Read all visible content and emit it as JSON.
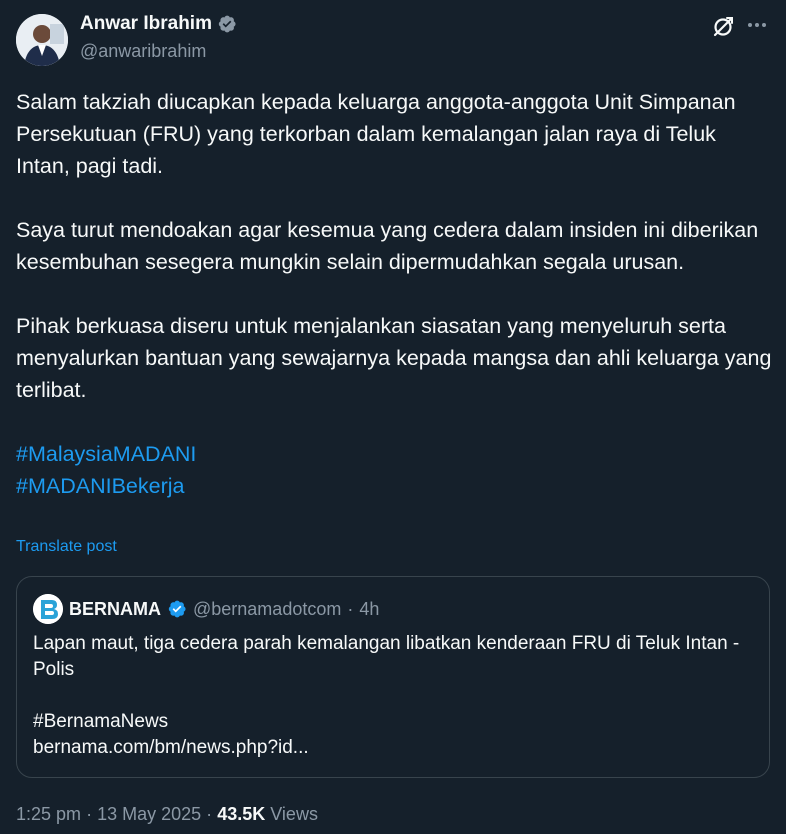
{
  "author": {
    "name": "Anwar Ibrahim",
    "handle": "@anwaribrahim",
    "verified": true
  },
  "post": {
    "paragraphs": [
      "Salam takziah diucapkan kepada keluarga anggota-anggota Unit Simpanan Persekutuan (FRU) yang terkorban dalam kemalangan jalan raya di Teluk Intan, pagi tadi.",
      "Saya turut mendoakan agar kesemua yang cedera dalam insiden ini diberikan kesembuhan sesegera mungkin selain dipermudahkan segala urusan.",
      "Pihak berkuasa diseru untuk menjalankan siasatan yang menyeluruh serta menyalurkan bantuan yang sewajarnya kepada mangsa dan ahli keluarga yang terlibat."
    ],
    "hashtags": [
      "#MalaysiaMADANI",
      "#MADANIBekerja"
    ],
    "translate_label": "Translate post"
  },
  "quote": {
    "name": "BERNAMA",
    "handle": "@bernamadotcom",
    "separator": "·",
    "time": "4h",
    "verified": true,
    "headline": "Lapan maut, tiga cedera parah kemalangan libatkan kenderaan FRU di Teluk Intan - Polis",
    "hashtag": "#BernamaNews",
    "link": "bernama.com/bm/news.php?id..."
  },
  "meta": {
    "time": "1:25 pm",
    "sep1": "·",
    "date": "13 May 2025",
    "sep2": "·",
    "views_count": "43.5K",
    "views_label": "Views"
  },
  "icons": {
    "grok": "grok-icon",
    "more": "more-icon",
    "verified": "verified-badge-icon"
  },
  "colors": {
    "background": "#15202b",
    "text": "#f7f9f9",
    "muted": "#8b98a5",
    "link": "#1d9bf0",
    "border": "#38444d"
  }
}
